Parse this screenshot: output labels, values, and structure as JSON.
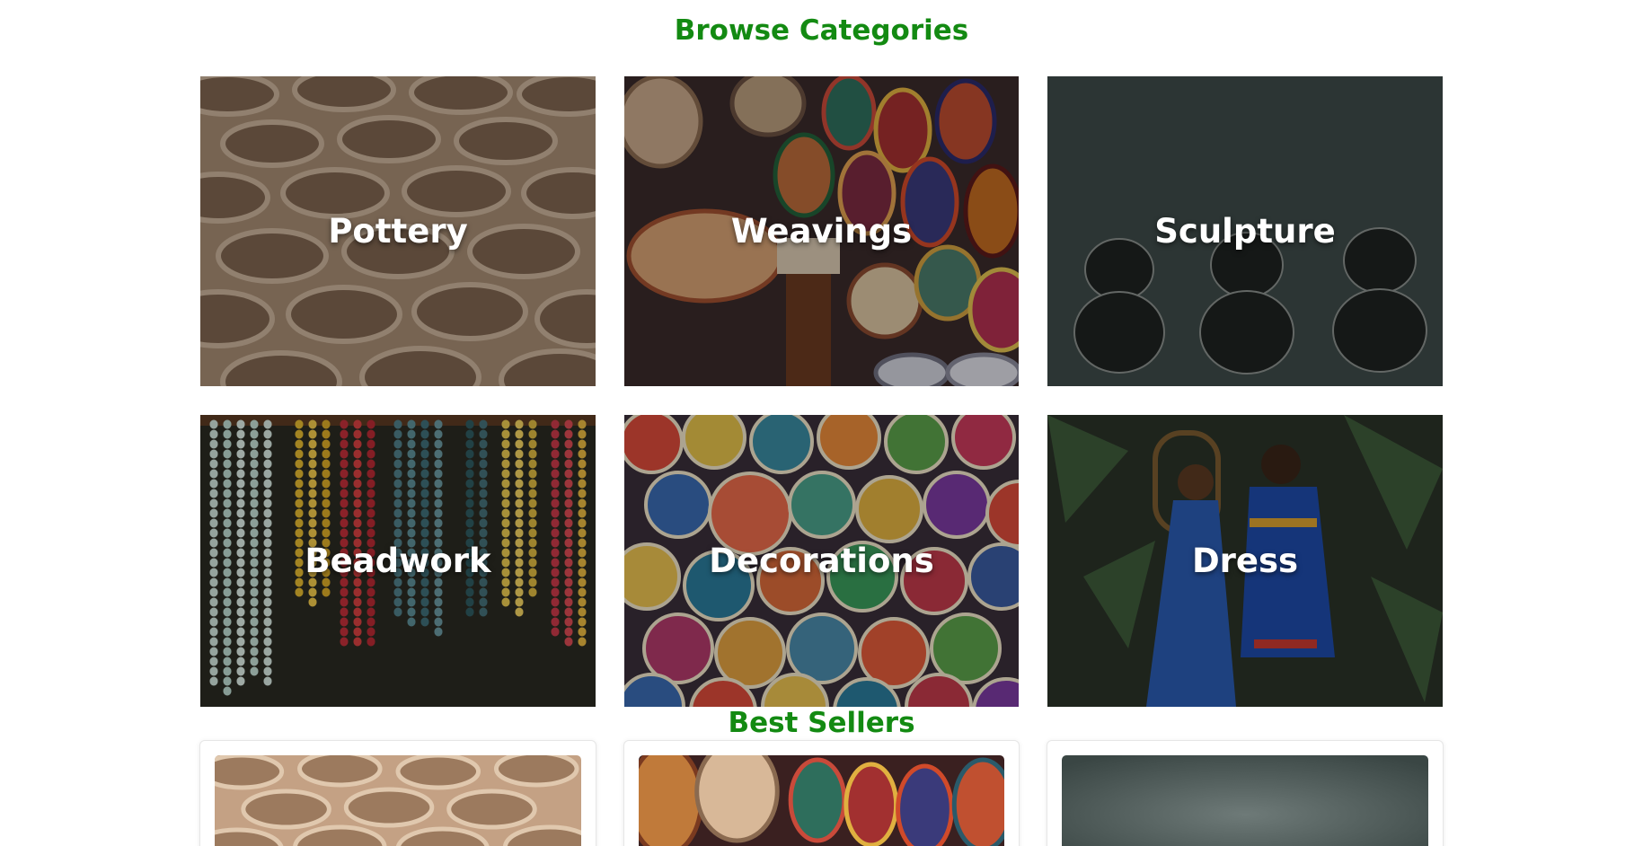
{
  "browse": {
    "title": "Browse Categories",
    "categories": [
      {
        "label": "Pottery"
      },
      {
        "label": "Weavings"
      },
      {
        "label": "Sculpture"
      },
      {
        "label": "Beadwork"
      },
      {
        "label": "Decorations"
      },
      {
        "label": "Dress"
      }
    ]
  },
  "best_sellers": {
    "title": "Best Sellers"
  },
  "colors": {
    "heading": "#138a12",
    "label": "#ffffff"
  }
}
